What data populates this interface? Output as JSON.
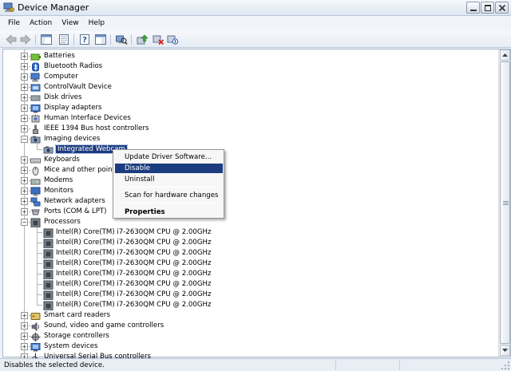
{
  "window": {
    "title": "Device Manager"
  },
  "menu": [
    "File",
    "Action",
    "View",
    "Help"
  ],
  "toolbar": {
    "buttons": [
      "back-icon",
      "forward-icon",
      "show-hide-console-tree-icon",
      "properties-icon",
      "help-icon",
      "action-pane-icon",
      "scan-hardware-icon",
      "update-driver-icon",
      "uninstall-icon",
      "disable-icon"
    ]
  },
  "tree": {
    "categories": [
      {
        "label": "Batteries",
        "icon": "battery-icon",
        "expanded": false
      },
      {
        "label": "Bluetooth Radios",
        "icon": "bluetooth-icon",
        "expanded": false
      },
      {
        "label": "Computer",
        "icon": "computer-icon",
        "expanded": false
      },
      {
        "label": "ControlVault Device",
        "icon": "device-icon",
        "expanded": false
      },
      {
        "label": "Disk drives",
        "icon": "disk-drive-icon",
        "expanded": false
      },
      {
        "label": "Display adapters",
        "icon": "display-adapter-icon",
        "expanded": false
      },
      {
        "label": "Human Interface Devices",
        "icon": "hid-icon",
        "expanded": false
      },
      {
        "label": "IEEE 1394 Bus host controllers",
        "icon": "ieee1394-icon",
        "expanded": false
      },
      {
        "label": "Imaging devices",
        "icon": "camera-icon",
        "expanded": true
      },
      {
        "label": "Integrated Webcam",
        "icon": "webcam-icon",
        "child": true,
        "selected": true
      },
      {
        "label": "Keyboards",
        "icon": "keyboard-icon",
        "expanded": false
      },
      {
        "label": "Mice and other pointin",
        "icon": "mouse-icon",
        "expanded": false
      },
      {
        "label": "Modems",
        "icon": "modem-icon",
        "expanded": false
      },
      {
        "label": "Monitors",
        "icon": "monitor-icon",
        "expanded": false
      },
      {
        "label": "Network adapters",
        "icon": "network-icon",
        "expanded": false
      },
      {
        "label": "Ports (COM & LPT)",
        "icon": "port-icon",
        "expanded": false
      },
      {
        "label": "Processors",
        "icon": "processor-icon",
        "expanded": true
      },
      {
        "label": "Intel(R) Core(TM) i7-2630QM CPU @ 2.00GHz",
        "icon": "cpu-icon",
        "child": true
      },
      {
        "label": "Intel(R) Core(TM) i7-2630QM CPU @ 2.00GHz",
        "icon": "cpu-icon",
        "child": true
      },
      {
        "label": "Intel(R) Core(TM) i7-2630QM CPU @ 2.00GHz",
        "icon": "cpu-icon",
        "child": true
      },
      {
        "label": "Intel(R) Core(TM) i7-2630QM CPU @ 2.00GHz",
        "icon": "cpu-icon",
        "child": true
      },
      {
        "label": "Intel(R) Core(TM) i7-2630QM CPU @ 2.00GHz",
        "icon": "cpu-icon",
        "child": true
      },
      {
        "label": "Intel(R) Core(TM) i7-2630QM CPU @ 2.00GHz",
        "icon": "cpu-icon",
        "child": true
      },
      {
        "label": "Intel(R) Core(TM) i7-2630QM CPU @ 2.00GHz",
        "icon": "cpu-icon",
        "child": true
      },
      {
        "label": "Intel(R) Core(TM) i7-2630QM CPU @ 2.00GHz",
        "icon": "cpu-icon",
        "child": true
      },
      {
        "label": "Smart card readers",
        "icon": "smart-card-icon",
        "expanded": false
      },
      {
        "label": "Sound, video and game controllers",
        "icon": "sound-icon",
        "expanded": false
      },
      {
        "label": "Storage controllers",
        "icon": "storage-icon",
        "expanded": false
      },
      {
        "label": "System devices",
        "icon": "system-icon",
        "expanded": false
      },
      {
        "label": "Universal Serial Bus controllers",
        "icon": "usb-icon",
        "expanded": false
      }
    ]
  },
  "context_menu": {
    "items": [
      {
        "label": "Update Driver Software...",
        "type": "item"
      },
      {
        "label": "Disable",
        "type": "item",
        "hover": true
      },
      {
        "label": "Uninstall",
        "type": "item"
      },
      {
        "type": "separator"
      },
      {
        "label": "Scan for hardware changes",
        "type": "item"
      },
      {
        "type": "separator"
      },
      {
        "label": "Properties",
        "type": "item",
        "bold": true
      }
    ]
  },
  "status": {
    "text": "Disables the selected device."
  },
  "colors": {
    "selection": "#1c3c80",
    "window_bg": "#eef2f8",
    "tree_bg": "#ffffff"
  }
}
